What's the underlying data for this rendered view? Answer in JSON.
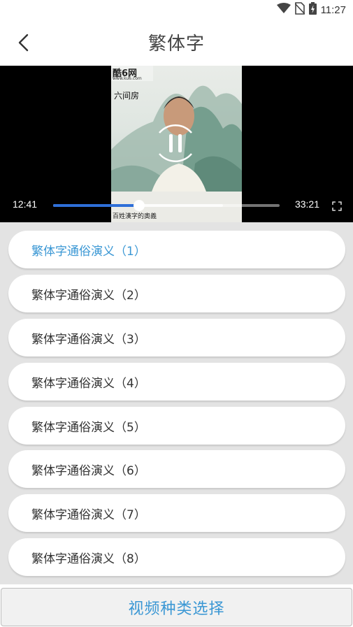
{
  "status_bar": {
    "time": "11:27",
    "icons": [
      "wifi-icon",
      "no-sim-icon",
      "battery-charging-icon"
    ]
  },
  "header": {
    "title": "繁体字",
    "back_icon": "chevron-left-icon"
  },
  "player": {
    "current_time": "12:41",
    "total_time": "33:21",
    "progress": 0.38,
    "buffered": 0.75,
    "state": "playing",
    "watermark_logo": "酷6网",
    "watermark_url": "www.ku6.com",
    "caption_top": "六间房",
    "caption_bottom": "百姓漢字的奧義"
  },
  "episodes": [
    {
      "label": "繁体字通俗演义（1）",
      "active": true
    },
    {
      "label": "繁体字通俗演义（2）",
      "active": false
    },
    {
      "label": "繁体字通俗演义（3）",
      "active": false
    },
    {
      "label": "繁体字通俗演义（4）",
      "active": false
    },
    {
      "label": "繁体字通俗演义（5）",
      "active": false
    },
    {
      "label": "繁体字通俗演义（6）",
      "active": false
    },
    {
      "label": "繁体字通俗演义（7）",
      "active": false
    },
    {
      "label": "繁体字通俗演义（8）",
      "active": false
    }
  ],
  "bottom_button": {
    "label": "视频种类选择"
  },
  "colors": {
    "accent": "#3a97d4",
    "seek_played": "#2e6fd8",
    "list_background": "#e3e3e3"
  }
}
